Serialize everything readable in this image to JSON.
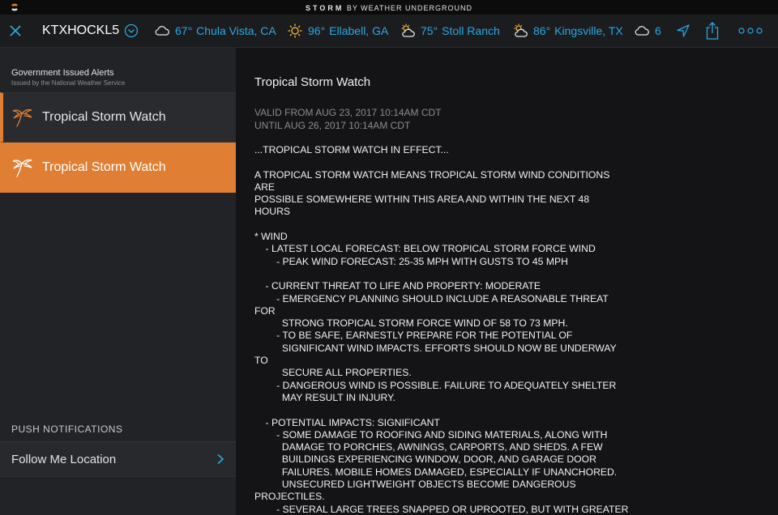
{
  "titlebar": {
    "brand_bold": "STORM",
    "brand_rest": " BY WEATHER UNDERGROUND"
  },
  "topbar": {
    "station": "KTXHOCKL5",
    "locations": [
      {
        "icon": "cloud-icon",
        "temp": "67°",
        "name": "Chula Vista, CA"
      },
      {
        "icon": "sun-icon",
        "temp": "96°",
        "name": "Ellabell, GA"
      },
      {
        "icon": "partly-cloudy-icon",
        "temp": "75°",
        "name": "Stoll Ranch"
      },
      {
        "icon": "partly-cloudy-icon",
        "temp": "86°",
        "name": "Kingsville, TX"
      },
      {
        "icon": "cloud-icon",
        "temp": "6",
        "name": ""
      }
    ]
  },
  "sidebar": {
    "header_title": "Government Issued Alerts",
    "header_sub": "Issued by the National Weather Service",
    "alerts": [
      {
        "label": "Tropical Storm Watch",
        "icon": "palm-tree-icon"
      },
      {
        "label": "Tropical Storm Watch",
        "icon": "palm-tree-icon"
      }
    ],
    "push_heading": "PUSH NOTIFICATIONS",
    "follow_label": "Follow Me Location"
  },
  "colors": {
    "accent": "#e07f33",
    "link": "#29a8e6"
  },
  "content": {
    "title": "Tropical Storm Watch",
    "valid_from": "VALID FROM AUG 23, 2017 10:14AM CDT",
    "valid_until": "UNTIL AUG 26, 2017 10:14AM CDT",
    "body": "...TROPICAL STORM WATCH IN EFFECT...\n\nA TROPICAL STORM WATCH MEANS TROPICAL STORM WIND CONDITIONS\nARE\nPOSSIBLE SOMEWHERE WITHIN THIS AREA AND WITHIN THE NEXT 48\nHOURS\n\n* WIND\n    - LATEST LOCAL FORECAST: BELOW TROPICAL STORM FORCE WIND\n        - PEAK WIND FORECAST: 25-35 MPH WITH GUSTS TO 45 MPH\n\n    - CURRENT THREAT TO LIFE AND PROPERTY: MODERATE\n        - EMERGENCY PLANNING SHOULD INCLUDE A REASONABLE THREAT\nFOR\n          STRONG TROPICAL STORM FORCE WIND OF 58 TO 73 MPH.\n        - TO BE SAFE, EARNESTLY PREPARE FOR THE POTENTIAL OF\n          SIGNIFICANT WIND IMPACTS. EFFORTS SHOULD NOW BE UNDERWAY\nTO\n          SECURE ALL PROPERTIES.\n        - DANGEROUS WIND IS POSSIBLE. FAILURE TO ADEQUATELY SHELTER\n          MAY RESULT IN INJURY.\n\n    - POTENTIAL IMPACTS: SIGNIFICANT\n        - SOME DAMAGE TO ROOFING AND SIDING MATERIALS, ALONG WITH\n          DAMAGE TO PORCHES, AWNINGS, CARPORTS, AND SHEDS. A FEW\n          BUILDINGS EXPERIENCING WINDOW, DOOR, AND GARAGE DOOR\n          FAILURES. MOBILE HOMES DAMAGED, ESPECIALLY IF UNANCHORED.\n          UNSECURED LIGHTWEIGHT OBJECTS BECOME DANGEROUS\nPROJECTILES.\n        - SEVERAL LARGE TREES SNAPPED OR UPROOTED, BUT WITH GREATER"
  }
}
